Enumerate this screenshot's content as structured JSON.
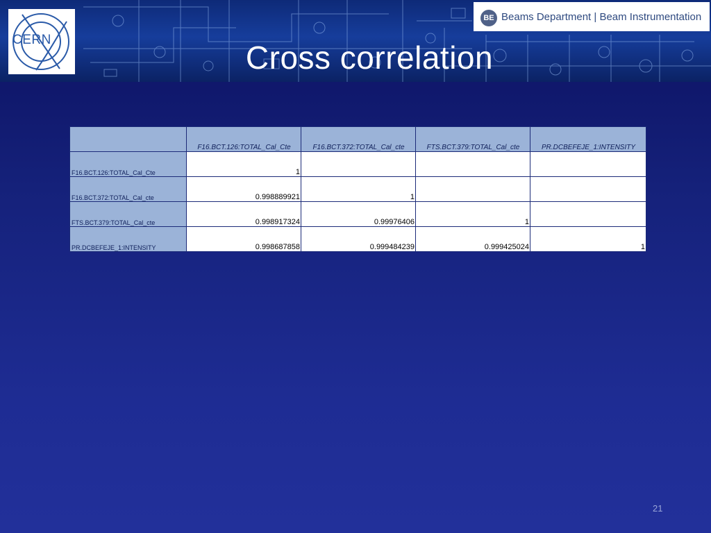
{
  "header": {
    "logo_text": "CERN",
    "department_badge": "BE",
    "department_label": "Beams Department | Beam Instrumentation"
  },
  "slide": {
    "title": "Cross correlation",
    "page_number": "21"
  },
  "table": {
    "columns": [
      "F16.BCT.126:TOTAL_Cal_Cte",
      "F16.BCT.372:TOTAL_Cal_cte",
      "FTS.BCT.379:TOTAL_Cal_cte",
      "PR.DCBEFEJE_1:INTENSITY"
    ],
    "rows": [
      {
        "label": "F16.BCT.126:TOTAL_Cal_Cte",
        "values": [
          "1",
          "",
          "",
          ""
        ]
      },
      {
        "label": "F16.BCT.372:TOTAL_Cal_cte",
        "values": [
          "0.998889921",
          "1",
          "",
          ""
        ]
      },
      {
        "label": "FTS.BCT.379:TOTAL_Cal_cte",
        "values": [
          "0.998917324",
          "0.99976406",
          "1",
          ""
        ]
      },
      {
        "label": "PR.DCBEFEJE_1:INTENSITY",
        "values": [
          "0.998687858",
          "0.999484239",
          "0.999425024",
          "1"
        ]
      }
    ]
  },
  "colors": {
    "background": "#1a268a",
    "header_cell": "#9bb3d8",
    "value_cell": "#ffffff",
    "title_text": "#ffffff"
  }
}
